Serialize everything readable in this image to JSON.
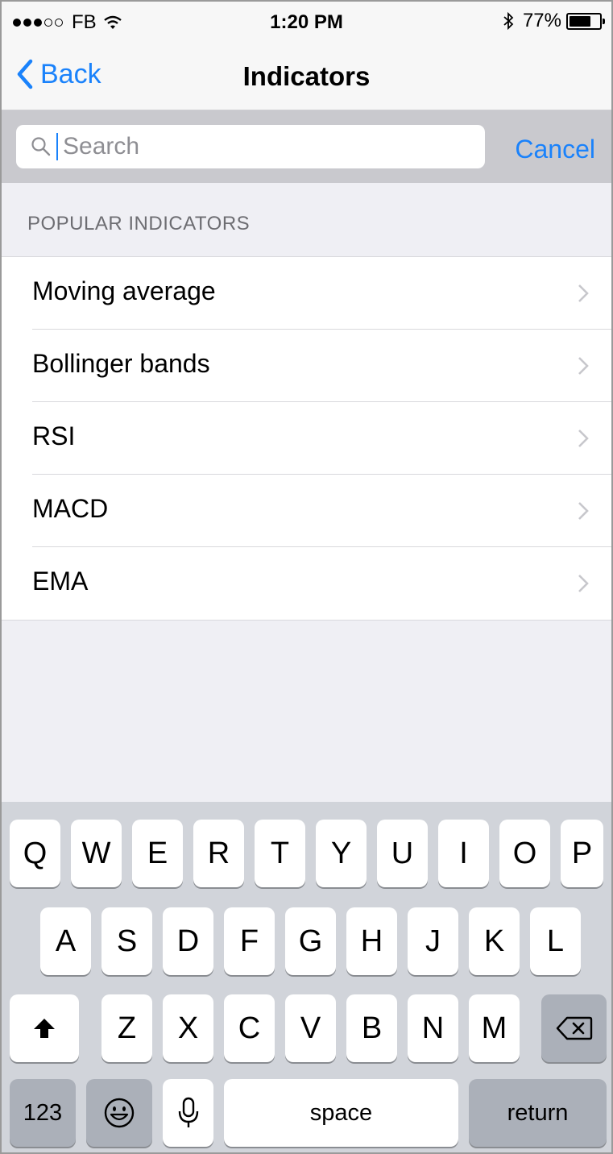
{
  "status_bar": {
    "carrier": "FB",
    "time": "1:20 PM",
    "battery": "77%",
    "battery_level": 0.77,
    "signal_icon": "signal-dots-icon",
    "wifi_icon": "wifi-icon",
    "bluetooth_icon": "bluetooth-icon"
  },
  "nav": {
    "back_label": "Back",
    "title": "Indicators"
  },
  "search": {
    "placeholder": "Search",
    "value": "",
    "cancel_label": "Cancel"
  },
  "section_header": "POPULAR INDICATORS",
  "indicators": [
    {
      "label": "Moving average"
    },
    {
      "label": "Bollinger bands"
    },
    {
      "label": "RSI"
    },
    {
      "label": "MACD"
    },
    {
      "label": "EMA"
    }
  ],
  "keyboard": {
    "row1": [
      "Q",
      "W",
      "E",
      "R",
      "T",
      "Y",
      "U",
      "I",
      "O",
      "P"
    ],
    "row2": [
      "A",
      "S",
      "D",
      "F",
      "G",
      "H",
      "J",
      "K",
      "L"
    ],
    "row3": [
      "Z",
      "X",
      "C",
      "V",
      "B",
      "N",
      "M"
    ],
    "numbers_label": "123",
    "space_label": "space",
    "return_label": "return"
  },
  "colors": {
    "accent": "#1a82fb",
    "background": "#efeff4",
    "keyboard_bg": "#d1d4da"
  }
}
